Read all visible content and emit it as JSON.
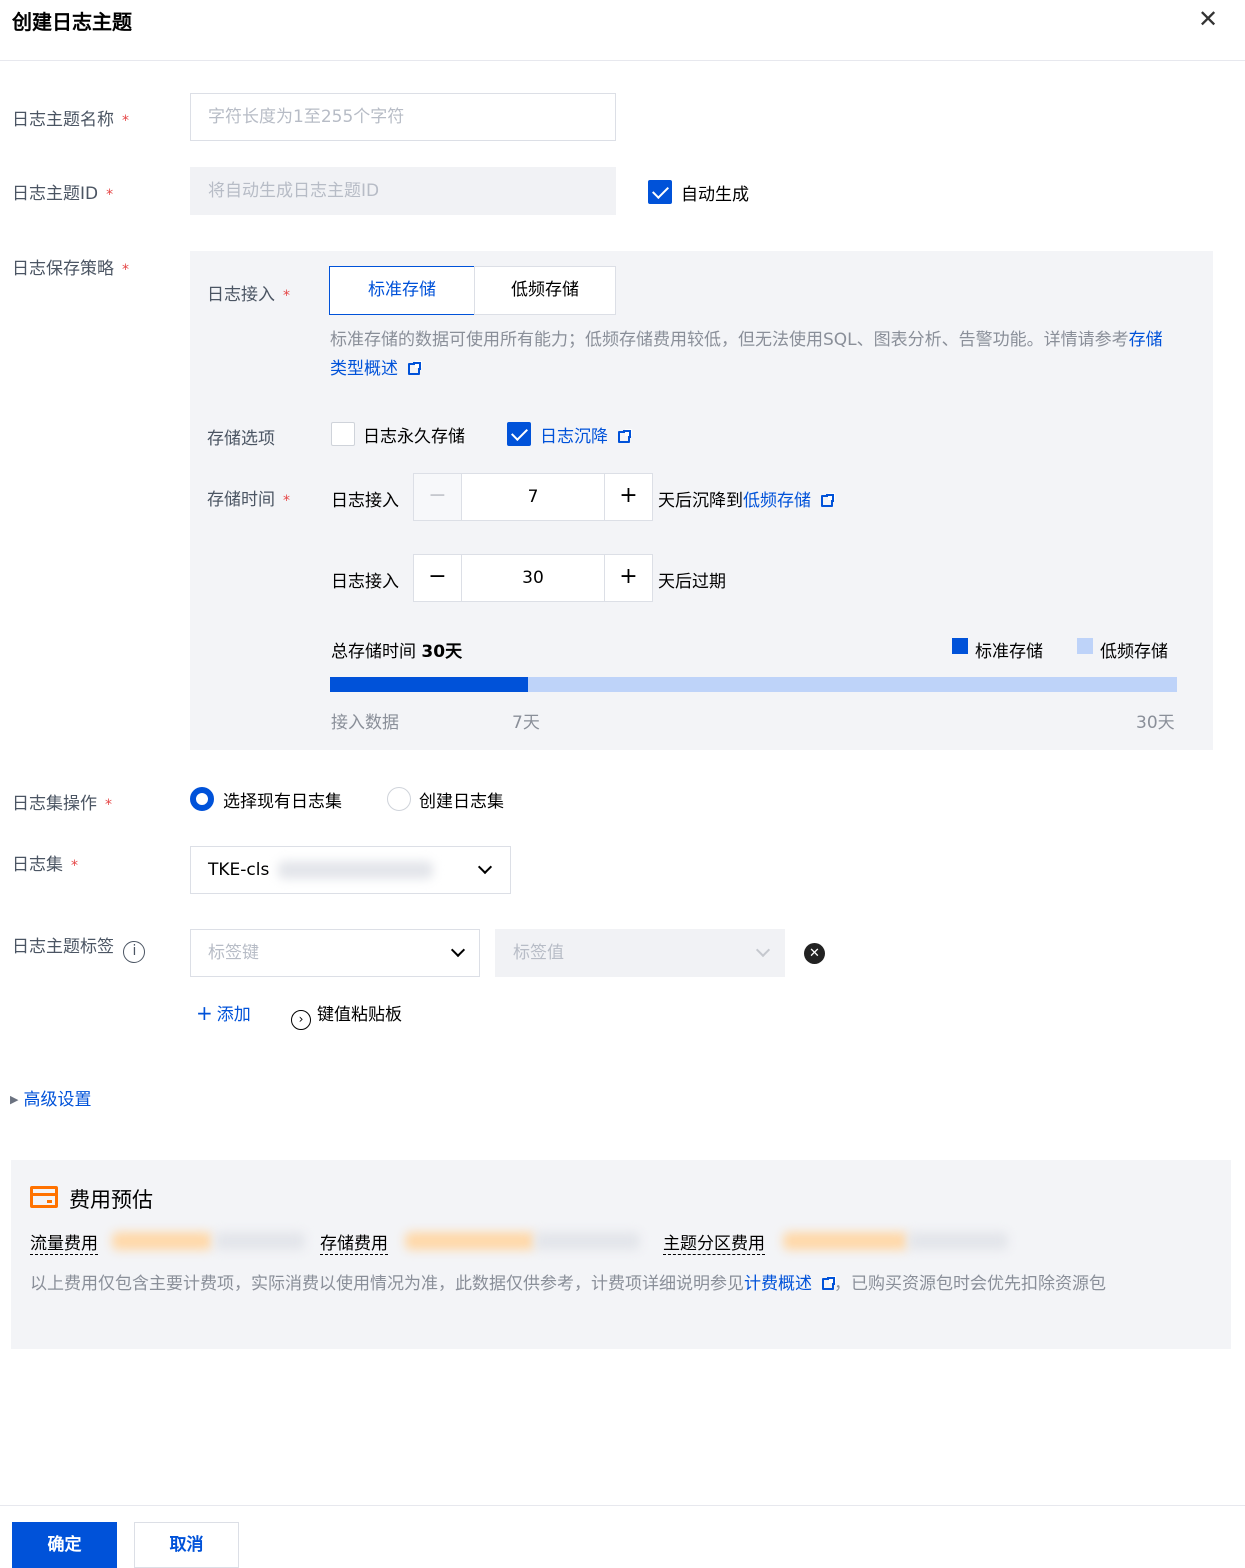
{
  "dialog": {
    "title": "创建日志主题",
    "close_icon": "close-icon"
  },
  "topic_name": {
    "label": "日志主题名称",
    "placeholder": "字符长度为1至255个字符"
  },
  "topic_id": {
    "label": "日志主题ID",
    "placeholder": "将自动生成日志主题ID",
    "auto_label": "自动生成",
    "auto_checked": true
  },
  "policy": {
    "label": "日志保存策略",
    "access_label": "日志接入",
    "tabs": [
      "标准存储",
      "低频存储"
    ],
    "active_tab": 0,
    "desc_text": "标准存储的数据可使用所有能力；低频存储费用较低，但无法使用SQL、图表分析、告警功能。详情请参考",
    "desc_link": "存储类型概述",
    "storage_options_label": "存储选项",
    "option_permanent": "日志永久存储",
    "option_permanent_checked": false,
    "option_sink": "日志沉降",
    "option_sink_checked": true,
    "storage_time_label": "存储时间",
    "row1_prefix": "日志接入",
    "row1_value": "7",
    "row1_suffix": "天后沉降到",
    "row1_suffix_link": "低频存储",
    "row2_prefix": "日志接入",
    "row2_value": "30",
    "row2_suffix": "天后过期",
    "total_label": "总存储时间",
    "total_value": "30天",
    "legend_std": "标准存储",
    "legend_low": "低频存储",
    "std_fraction": 0.2333,
    "axis_start": "接入数据",
    "axis_mid": "7天",
    "axis_end": "30天",
    "colors": {
      "std": "#0052d9",
      "low": "#bed3f9"
    }
  },
  "logset_op": {
    "label": "日志集操作",
    "option_existing": "选择现有日志集",
    "option_create": "创建日志集",
    "selected": "existing"
  },
  "logset": {
    "label": "日志集",
    "value": "TKE-cls"
  },
  "tags": {
    "label": "日志主题标签",
    "key_placeholder": "标签键",
    "value_placeholder": "标签值",
    "add_label": "添加",
    "paste_label": "键值粘贴板"
  },
  "advanced": {
    "label": "高级设置"
  },
  "cost": {
    "title": "费用预估",
    "traffic_label": "流量费用",
    "storage_label": "存储费用",
    "partition_label": "主题分区费用",
    "note_text": "以上费用仅包含主要计费项，实际消费以使用情况为准，此数据仅供参考，计费项详细说明参见",
    "note_link": "计费概述",
    "note_tail": "，已购买资源包时会优先扣除资源包"
  },
  "footer": {
    "confirm": "确定",
    "cancel": "取消"
  }
}
